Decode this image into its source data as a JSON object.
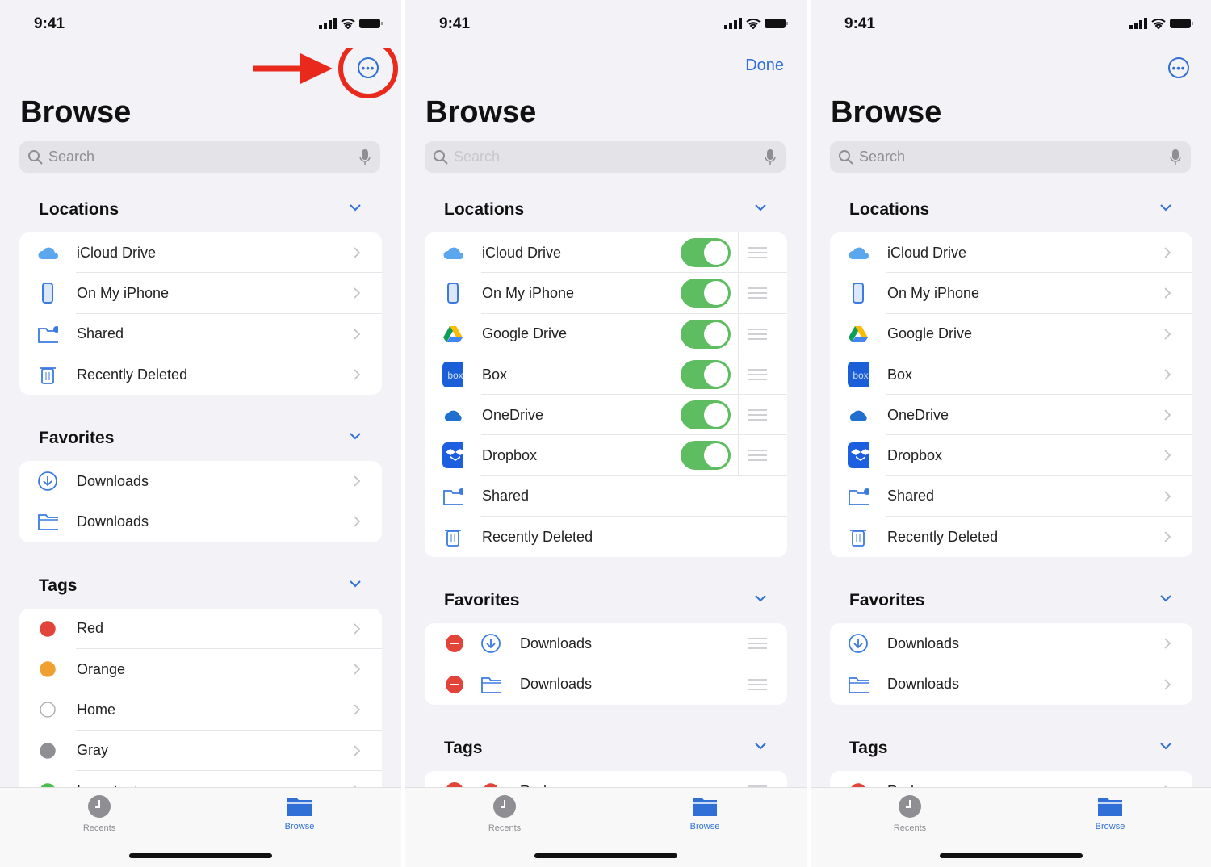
{
  "colors": {
    "accent": "#2f6fd6",
    "toggle_on": "#5dbd60",
    "delete": "#e2443a",
    "annotation": "#e8291c"
  },
  "panels": [
    {
      "time": "9:41",
      "nav": {
        "type": "more",
        "icon": "ellipsis-circle-icon"
      },
      "title": "Browse",
      "search_placeholder": "Search",
      "edit": false,
      "sections": [
        {
          "label": "Locations",
          "rows": [
            {
              "icon": "icloud",
              "label": "iCloud Drive"
            },
            {
              "icon": "iphone",
              "label": "On My iPhone"
            },
            {
              "icon": "shared",
              "label": "Shared"
            },
            {
              "icon": "trash",
              "label": "Recently Deleted"
            }
          ]
        },
        {
          "label": "Favorites",
          "rows": [
            {
              "icon": "download",
              "label": "Downloads"
            },
            {
              "icon": "folder",
              "label": "Downloads"
            }
          ]
        },
        {
          "label": "Tags",
          "rows": [
            {
              "icon": "tag",
              "color": "#e2443a",
              "label": "Red"
            },
            {
              "icon": "tag",
              "color": "#f0a030",
              "label": "Orange"
            },
            {
              "icon": "tag",
              "color": "#ffffff",
              "label": "Home"
            },
            {
              "icon": "tag",
              "color": "#8e8e93",
              "label": "Gray"
            },
            {
              "icon": "tag",
              "color": "#4cbb50",
              "label": "Important"
            }
          ]
        }
      ]
    },
    {
      "time": "9:41",
      "nav": {
        "type": "text",
        "label": "Done"
      },
      "title": "Browse",
      "search_placeholder": "Search",
      "edit": true,
      "sections": [
        {
          "label": "Locations",
          "rows": [
            {
              "icon": "icloud",
              "label": "iCloud Drive",
              "toggle": true
            },
            {
              "icon": "iphone",
              "label": "On My iPhone",
              "toggle": true
            },
            {
              "icon": "gdrive",
              "label": "Google Drive",
              "toggle": true
            },
            {
              "icon": "box",
              "label": "Box",
              "toggle": true
            },
            {
              "icon": "onedrive",
              "label": "OneDrive",
              "toggle": true
            },
            {
              "icon": "dropbox",
              "label": "Dropbox",
              "toggle": true
            },
            {
              "icon": "shared",
              "label": "Shared"
            },
            {
              "icon": "trash",
              "label": "Recently Deleted"
            }
          ]
        },
        {
          "label": "Favorites",
          "rows": [
            {
              "icon": "download",
              "label": "Downloads",
              "remove": true
            },
            {
              "icon": "folder",
              "label": "Downloads",
              "remove": true
            }
          ]
        },
        {
          "label": "Tags",
          "rows": [
            {
              "icon": "tag",
              "color": "#e2443a",
              "label": "Red",
              "remove": true
            }
          ]
        }
      ]
    },
    {
      "time": "9:41",
      "nav": {
        "type": "more",
        "icon": "ellipsis-circle-icon"
      },
      "title": "Browse",
      "search_placeholder": "Search",
      "edit": false,
      "sections": [
        {
          "label": "Locations",
          "rows": [
            {
              "icon": "icloud",
              "label": "iCloud Drive"
            },
            {
              "icon": "iphone",
              "label": "On My iPhone"
            },
            {
              "icon": "gdrive",
              "label": "Google Drive"
            },
            {
              "icon": "box",
              "label": "Box"
            },
            {
              "icon": "onedrive",
              "label": "OneDrive"
            },
            {
              "icon": "dropbox",
              "label": "Dropbox"
            },
            {
              "icon": "shared",
              "label": "Shared"
            },
            {
              "icon": "trash",
              "label": "Recently Deleted"
            }
          ]
        },
        {
          "label": "Favorites",
          "rows": [
            {
              "icon": "download",
              "label": "Downloads"
            },
            {
              "icon": "folder",
              "label": "Downloads"
            }
          ]
        },
        {
          "label": "Tags",
          "rows": [
            {
              "icon": "tag",
              "color": "#e2443a",
              "label": "Red"
            }
          ]
        }
      ]
    }
  ],
  "tabbar": {
    "recents": "Recents",
    "browse": "Browse"
  }
}
